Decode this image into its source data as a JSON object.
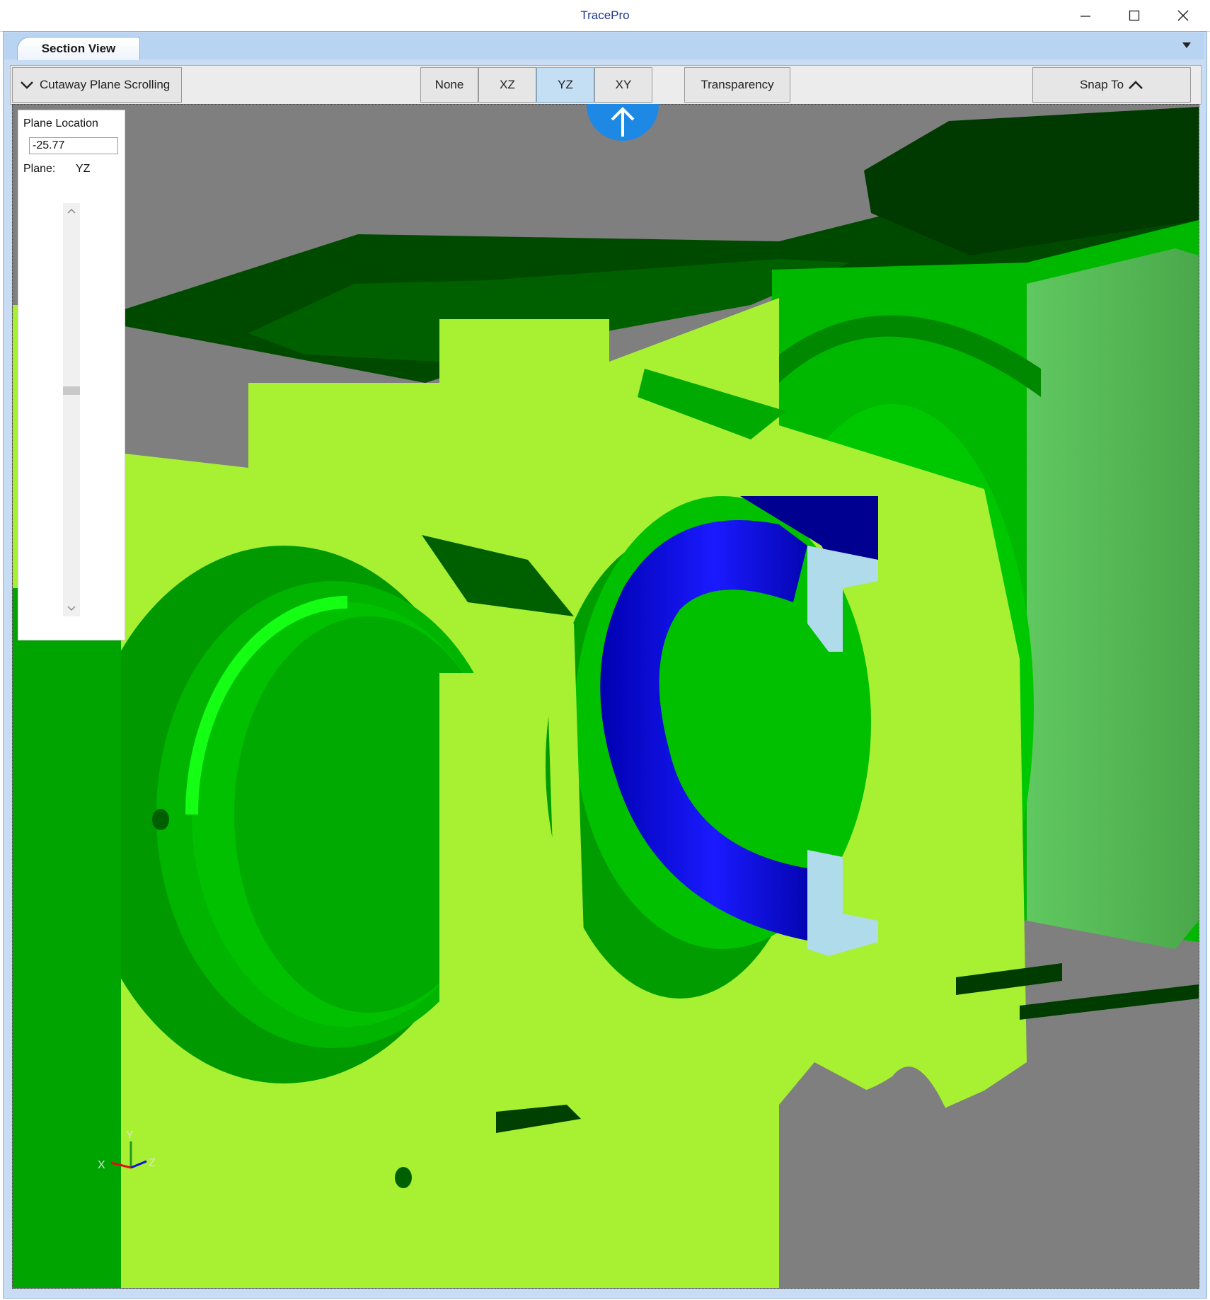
{
  "window": {
    "title": "TracePro",
    "minimize_icon": "minimize-icon",
    "maximize_icon": "maximize-icon",
    "close_icon": "close-icon"
  },
  "tabs": [
    {
      "label": "Section View",
      "selected": true
    }
  ],
  "toolbar": {
    "cutaway_label": "Cutaway Plane Scrolling",
    "planes": [
      "None",
      "XZ",
      "YZ",
      "XY"
    ],
    "selected_plane": "YZ",
    "transparency_label": "Transparency",
    "snap_label": "Snap To"
  },
  "panel": {
    "plane_location_label": "Plane Location",
    "plane_location_value": "-25.77",
    "plane_label": "Plane:",
    "plane_value": "YZ",
    "slider_position": 0.45
  },
  "axis_triad": {
    "x": "X",
    "y": "Y",
    "z": "Z"
  },
  "colors": {
    "section_cut": "#a6f030",
    "body_green": "#00c000",
    "dark_green": "#005000",
    "part_blue": "#0000c8",
    "background": "#7f7f7f",
    "selected_button": "#c4dff4",
    "arrow_button": "#1e88e5"
  }
}
